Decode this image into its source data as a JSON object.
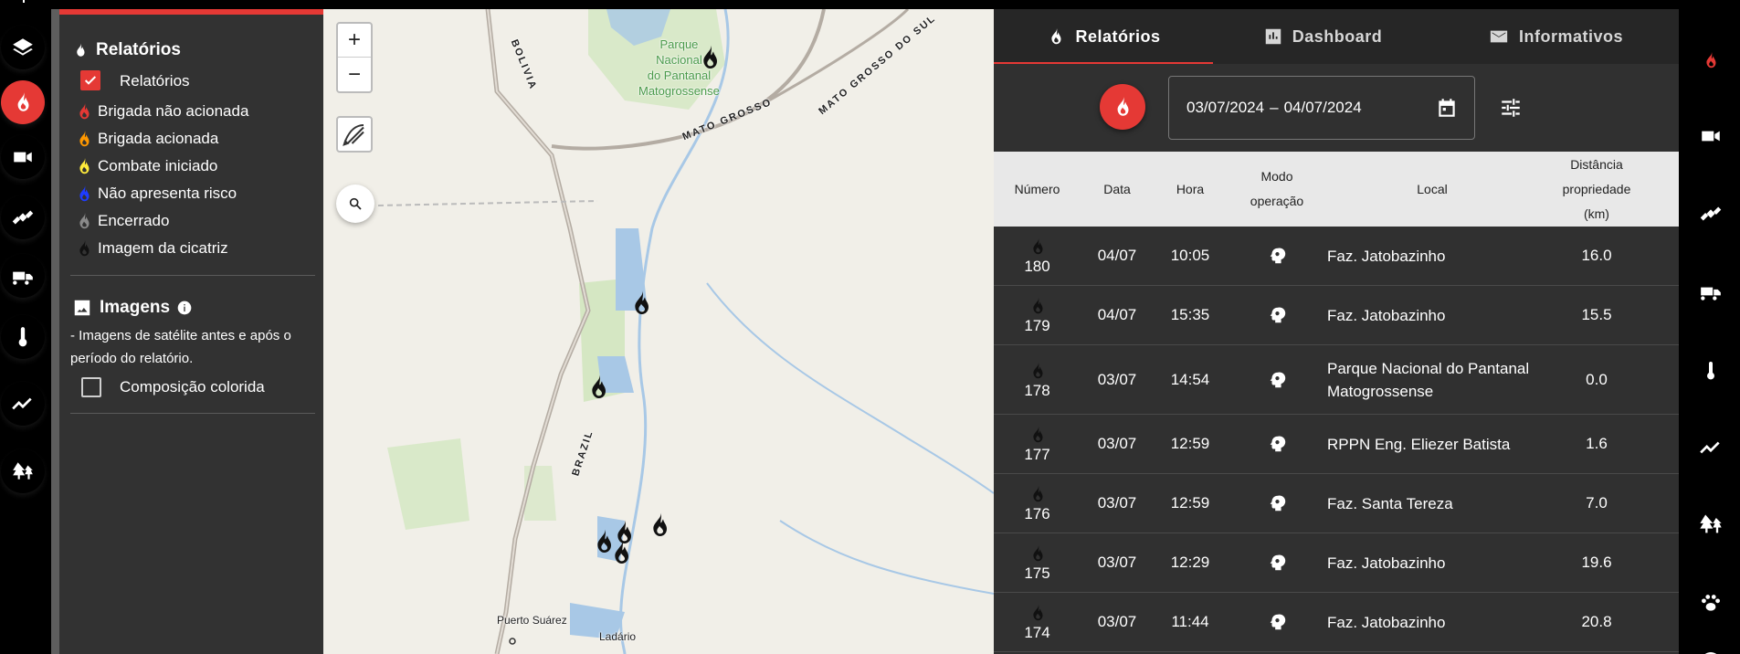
{
  "colors": {
    "accent": "#e53935",
    "flame_red": "#e53935",
    "flame_orange": "#ff9800",
    "flame_yellow": "#ffeb3b",
    "flame_blue": "#1e3cff",
    "flame_gray": "#8a8a8a",
    "flame_black": "#111111"
  },
  "left_rail": {
    "items": [
      "layers-icon",
      "fire-icon",
      "camera-icon",
      "satellite-icon",
      "fire-truck-icon",
      "thermometer-icon",
      "trend-icon",
      "forest-icon"
    ]
  },
  "legend": {
    "section_title": "Relatórios",
    "checkbox_label": "Relatórios",
    "items": [
      {
        "label": "Brigada não acionada",
        "color": "#e53935"
      },
      {
        "label": "Brigada acionada",
        "color": "#ff9800"
      },
      {
        "label": "Combate iniciado",
        "color": "#ffeb3b"
      },
      {
        "label": "Não apresenta risco",
        "color": "#1e3cff"
      },
      {
        "label": "Encerrado",
        "color": "#8a8a8a"
      },
      {
        "label": "Imagem da cicatriz",
        "color": "#111111"
      }
    ],
    "images_title": "Imagens",
    "images_note": "- Imagens de satélite antes e após o período do relatório.",
    "composite_label": "Composição colorida"
  },
  "map": {
    "zoom_in": "+",
    "zoom_out": "−",
    "labels": {
      "park": "Parque\nNacional\ndo Pantanal\nMatogrossense",
      "bolivia": "BOLIVIA",
      "mato_grosso": "MATO GROSSO",
      "mato_grosso_do_sul": "MATO GROSSO DO SUL",
      "brazil": "BRAZIL",
      "puerto_suarez": "Puerto Suárez",
      "ladario": "Ladário"
    }
  },
  "tabs": [
    {
      "label": "Relatórios",
      "icon": "fire-icon"
    },
    {
      "label": "Dashboard",
      "icon": "dashboard-icon"
    },
    {
      "label": "Informativos",
      "icon": "mail-icon"
    }
  ],
  "date_range": {
    "start": "03/07/2024",
    "separator": "–",
    "end": "04/07/2024"
  },
  "table": {
    "headers": {
      "numero": "Número",
      "data": "Data",
      "hora": "Hora",
      "modo": "Modo\noperação",
      "local": "Local",
      "distancia": "Distância\npropriedade\n(km)"
    },
    "rows": [
      {
        "numero": "180",
        "data": "04/07",
        "hora": "10:05",
        "local": "Faz. Jatobazinho",
        "distancia": "16.0"
      },
      {
        "numero": "179",
        "data": "04/07",
        "hora": "15:35",
        "local": "Faz. Jatobazinho",
        "distancia": "15.5"
      },
      {
        "numero": "178",
        "data": "03/07",
        "hora": "14:54",
        "local": "Parque Nacional do Pantanal Matogrossense",
        "distancia": "0.0"
      },
      {
        "numero": "177",
        "data": "03/07",
        "hora": "12:59",
        "local": "RPPN Eng. Eliezer Batista",
        "distancia": "1.6"
      },
      {
        "numero": "176",
        "data": "03/07",
        "hora": "12:59",
        "local": "Faz. Santa Tereza",
        "distancia": "7.0"
      },
      {
        "numero": "175",
        "data": "03/07",
        "hora": "12:29",
        "local": "Faz. Jatobazinho",
        "distancia": "19.6"
      },
      {
        "numero": "174",
        "data": "03/07",
        "hora": "11:44",
        "local": "Faz. Jatobazinho",
        "distancia": "20.8"
      }
    ]
  },
  "right_rail": {
    "items": [
      "fire-icon",
      "camera-icon",
      "satellite-icon",
      "fire-truck-icon",
      "thermometer-icon",
      "trend-icon",
      "forest-icon",
      "paw-icon"
    ]
  }
}
